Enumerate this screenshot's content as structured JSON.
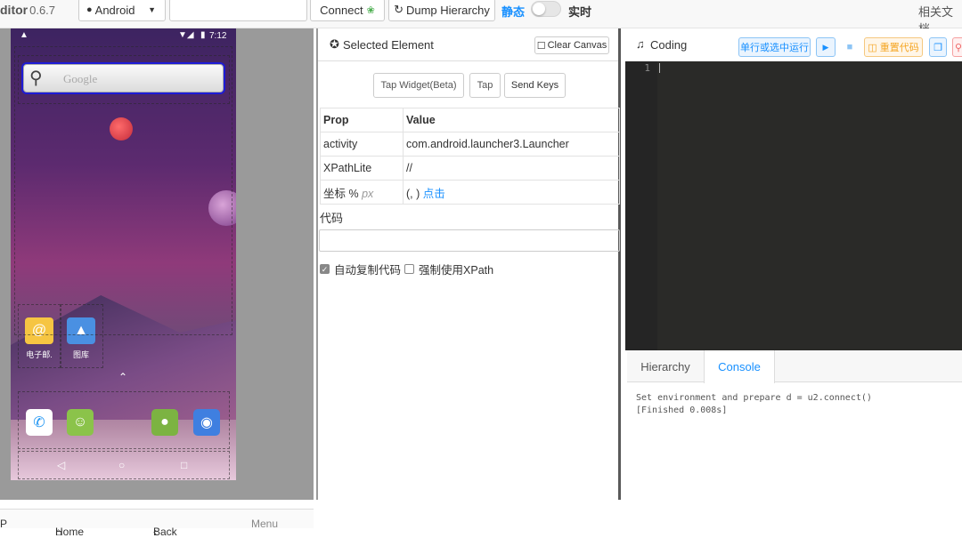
{
  "topbar": {
    "brand": "ditor",
    "version": "0.6.7",
    "platform": "Android",
    "device_input": "",
    "connect_label": "Connect",
    "dump_label": "Dump Hierarchy",
    "mode_static": "静态",
    "mode_realtime": "实时",
    "docs": "相关文档"
  },
  "phone": {
    "time": "7:12",
    "search_placeholder": "Google",
    "apps": [
      {
        "label": "电子邮.",
        "icon": "email-icon"
      },
      {
        "label": "图库",
        "icon": "gallery-icon"
      }
    ],
    "dock": [
      {
        "icon": "phone-icon"
      },
      {
        "icon": "messaging-icon"
      },
      {
        "icon": "android-icon"
      },
      {
        "icon": "camera-icon"
      }
    ],
    "nav": [
      "◁",
      "○",
      "□"
    ]
  },
  "device_controls": {
    "left_partial": "P",
    "home": "Home",
    "back": "Back",
    "menu": "Menu"
  },
  "selected": {
    "title": "Selected Element",
    "clear_canvas": "Clear Canvas",
    "tap_widget": "Tap Widget(Beta)",
    "tap": "Tap",
    "send_keys": "Send Keys",
    "headers": {
      "prop": "Prop",
      "value": "Value"
    },
    "rows": [
      {
        "prop": "activity",
        "value": "com.android.launcher3.Launcher"
      },
      {
        "prop": "XPathLite",
        "value": "//"
      }
    ],
    "coord_prop": "坐标 %",
    "coord_unit": "px",
    "coord_value": "(, )",
    "coord_link": "点击",
    "code_label": "代码",
    "code_value": "",
    "auto_copy": "自动复制代码",
    "force_xpath": "强制使用XPath"
  },
  "coding": {
    "title": "Coding",
    "run_label": "单行或选中运行",
    "reset_label": "重置代码",
    "line_number": "1",
    "tabs": {
      "hierarchy": "Hierarchy",
      "console": "Console"
    },
    "console_lines": [
      "Set environment and prepare d = u2.connect()",
      "[Finished 0.008s]"
    ]
  },
  "colors": {
    "accent": "#1890ff",
    "editor_bg": "#2a2a28",
    "reset_orange": "#f5a623"
  }
}
